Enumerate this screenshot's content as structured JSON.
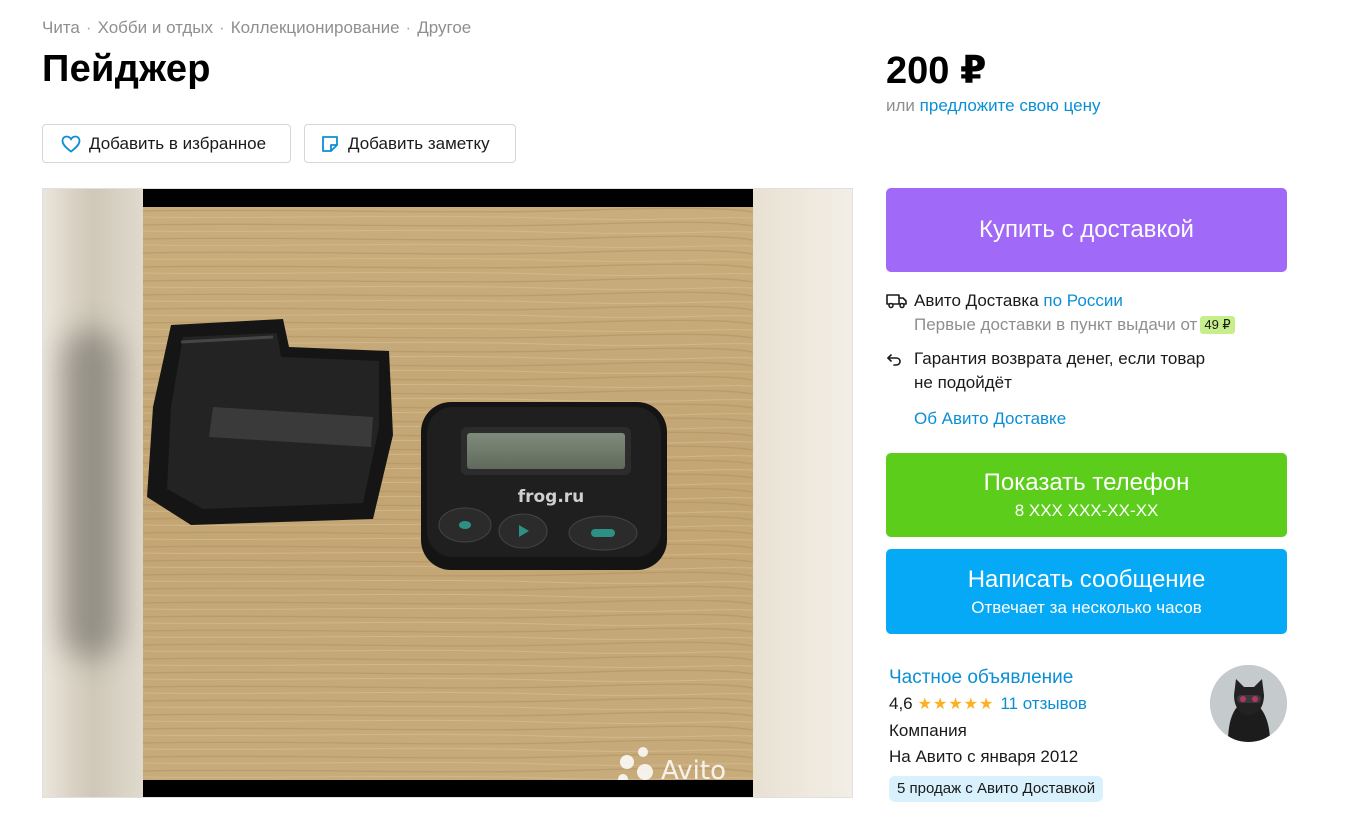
{
  "breadcrumb": [
    "Чита",
    "Хобби и отдых",
    "Коллекционирование",
    "Другое"
  ],
  "breadcrumb_separator": "·",
  "title": "Пейджер",
  "actions": {
    "favorite_label": "Добавить в избранное",
    "note_label": "Добавить заметку"
  },
  "gallery": {
    "photo_device_label": "frog.ru",
    "watermark": "Avito"
  },
  "price": {
    "amount": "200 ₽",
    "or_text": "или",
    "offer_link": "предложите свою цену"
  },
  "buy_button": {
    "label": "Купить с доставкой"
  },
  "delivery": {
    "service": "Авито Доставка",
    "region_link": "по России",
    "first_delivery_text": "Первые доставки в пункт выдачи от",
    "first_delivery_price": "49 ₽",
    "guarantee_line1": "Гарантия возврата денег, если товар",
    "guarantee_line2": "не подойдёт",
    "about_link": "Об Авито Доставке"
  },
  "phone_button": {
    "label": "Показать телефон",
    "number": "8 XXX XXX-XX-XX"
  },
  "message_button": {
    "label": "Написать сообщение",
    "sub": "Отвечает за несколько часов"
  },
  "seller": {
    "type_link": "Частное объявление",
    "rating": "4,6",
    "stars": "★★★★★",
    "rating_value": 4.6,
    "reviews_link": "11 отзывов",
    "kind": "Компания",
    "since": "На Авито с января 2012",
    "sales_badge": "5 продаж с Авито Доставкой"
  },
  "colors": {
    "buy": "#a169f7",
    "phone": "#5ccd1b",
    "message": "#05a9f5",
    "link": "#0a8fd5",
    "star": "#ffb021"
  },
  "icons": {
    "favorite": "heart-icon",
    "note": "note-icon",
    "delivery": "truck-icon",
    "guarantee": "return-arrow-icon"
  }
}
